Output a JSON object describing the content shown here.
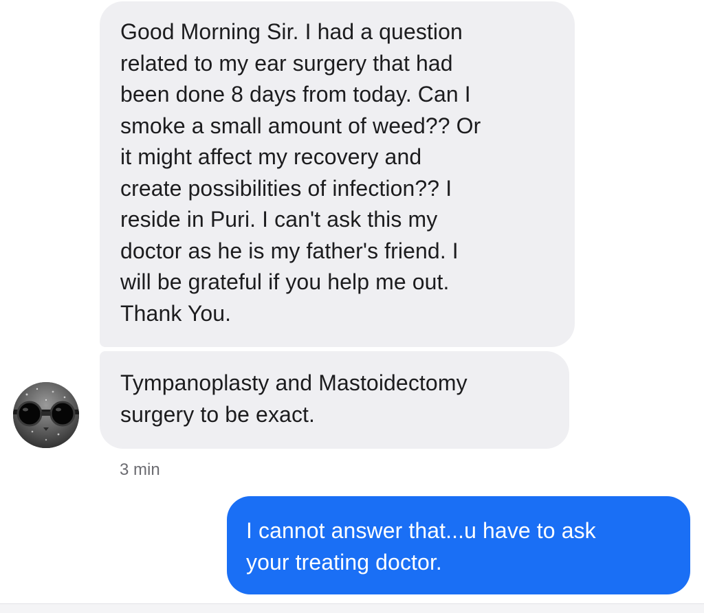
{
  "messages": [
    {
      "direction": "incoming",
      "text": "Good Morning Sir. I had a question\nrelated to my ear surgery that had\nbeen done 8 days from today. Can I\nsmoke a small amount of weed?? Or\nit might affect my recovery and\ncreate possibilities of infection?? I\nreside in Puri. I can't ask this my\ndoctor as he is my father's friend. I\nwill be grateful if you help me out.\nThank You."
    },
    {
      "direction": "incoming",
      "text": "Tympanoplasty and Mastoidectomy\nsurgery to be exact."
    },
    {
      "direction": "outgoing",
      "text": "I cannot answer that...u have to ask\nyour treating doctor."
    }
  ],
  "timestamp": "3 min",
  "avatar_icon": "cat-with-goggles-avatar",
  "colors": {
    "incoming_bubble": "#efeff2",
    "outgoing_bubble": "#1a6ff5",
    "incoming_text": "#1c1c1e",
    "outgoing_text": "#ffffff",
    "timestamp_text": "#6b6b70"
  }
}
